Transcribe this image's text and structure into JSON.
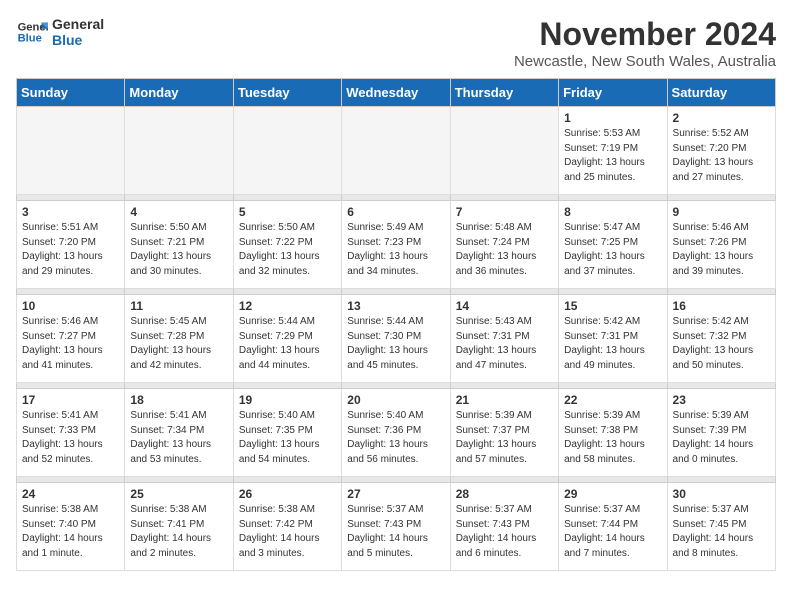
{
  "logo": {
    "line1": "General",
    "line2": "Blue"
  },
  "title": "November 2024",
  "location": "Newcastle, New South Wales, Australia",
  "weekdays": [
    "Sunday",
    "Monday",
    "Tuesday",
    "Wednesday",
    "Thursday",
    "Friday",
    "Saturday"
  ],
  "weeks": [
    [
      {
        "day": "",
        "details": ""
      },
      {
        "day": "",
        "details": ""
      },
      {
        "day": "",
        "details": ""
      },
      {
        "day": "",
        "details": ""
      },
      {
        "day": "",
        "details": ""
      },
      {
        "day": "1",
        "details": "Sunrise: 5:53 AM\nSunset: 7:19 PM\nDaylight: 13 hours\nand 25 minutes."
      },
      {
        "day": "2",
        "details": "Sunrise: 5:52 AM\nSunset: 7:20 PM\nDaylight: 13 hours\nand 27 minutes."
      }
    ],
    [
      {
        "day": "3",
        "details": "Sunrise: 5:51 AM\nSunset: 7:20 PM\nDaylight: 13 hours\nand 29 minutes."
      },
      {
        "day": "4",
        "details": "Sunrise: 5:50 AM\nSunset: 7:21 PM\nDaylight: 13 hours\nand 30 minutes."
      },
      {
        "day": "5",
        "details": "Sunrise: 5:50 AM\nSunset: 7:22 PM\nDaylight: 13 hours\nand 32 minutes."
      },
      {
        "day": "6",
        "details": "Sunrise: 5:49 AM\nSunset: 7:23 PM\nDaylight: 13 hours\nand 34 minutes."
      },
      {
        "day": "7",
        "details": "Sunrise: 5:48 AM\nSunset: 7:24 PM\nDaylight: 13 hours\nand 36 minutes."
      },
      {
        "day": "8",
        "details": "Sunrise: 5:47 AM\nSunset: 7:25 PM\nDaylight: 13 hours\nand 37 minutes."
      },
      {
        "day": "9",
        "details": "Sunrise: 5:46 AM\nSunset: 7:26 PM\nDaylight: 13 hours\nand 39 minutes."
      }
    ],
    [
      {
        "day": "10",
        "details": "Sunrise: 5:46 AM\nSunset: 7:27 PM\nDaylight: 13 hours\nand 41 minutes."
      },
      {
        "day": "11",
        "details": "Sunrise: 5:45 AM\nSunset: 7:28 PM\nDaylight: 13 hours\nand 42 minutes."
      },
      {
        "day": "12",
        "details": "Sunrise: 5:44 AM\nSunset: 7:29 PM\nDaylight: 13 hours\nand 44 minutes."
      },
      {
        "day": "13",
        "details": "Sunrise: 5:44 AM\nSunset: 7:30 PM\nDaylight: 13 hours\nand 45 minutes."
      },
      {
        "day": "14",
        "details": "Sunrise: 5:43 AM\nSunset: 7:31 PM\nDaylight: 13 hours\nand 47 minutes."
      },
      {
        "day": "15",
        "details": "Sunrise: 5:42 AM\nSunset: 7:31 PM\nDaylight: 13 hours\nand 49 minutes."
      },
      {
        "day": "16",
        "details": "Sunrise: 5:42 AM\nSunset: 7:32 PM\nDaylight: 13 hours\nand 50 minutes."
      }
    ],
    [
      {
        "day": "17",
        "details": "Sunrise: 5:41 AM\nSunset: 7:33 PM\nDaylight: 13 hours\nand 52 minutes."
      },
      {
        "day": "18",
        "details": "Sunrise: 5:41 AM\nSunset: 7:34 PM\nDaylight: 13 hours\nand 53 minutes."
      },
      {
        "day": "19",
        "details": "Sunrise: 5:40 AM\nSunset: 7:35 PM\nDaylight: 13 hours\nand 54 minutes."
      },
      {
        "day": "20",
        "details": "Sunrise: 5:40 AM\nSunset: 7:36 PM\nDaylight: 13 hours\nand 56 minutes."
      },
      {
        "day": "21",
        "details": "Sunrise: 5:39 AM\nSunset: 7:37 PM\nDaylight: 13 hours\nand 57 minutes."
      },
      {
        "day": "22",
        "details": "Sunrise: 5:39 AM\nSunset: 7:38 PM\nDaylight: 13 hours\nand 58 minutes."
      },
      {
        "day": "23",
        "details": "Sunrise: 5:39 AM\nSunset: 7:39 PM\nDaylight: 14 hours\nand 0 minutes."
      }
    ],
    [
      {
        "day": "24",
        "details": "Sunrise: 5:38 AM\nSunset: 7:40 PM\nDaylight: 14 hours\nand 1 minute."
      },
      {
        "day": "25",
        "details": "Sunrise: 5:38 AM\nSunset: 7:41 PM\nDaylight: 14 hours\nand 2 minutes."
      },
      {
        "day": "26",
        "details": "Sunrise: 5:38 AM\nSunset: 7:42 PM\nDaylight: 14 hours\nand 3 minutes."
      },
      {
        "day": "27",
        "details": "Sunrise: 5:37 AM\nSunset: 7:43 PM\nDaylight: 14 hours\nand 5 minutes."
      },
      {
        "day": "28",
        "details": "Sunrise: 5:37 AM\nSunset: 7:43 PM\nDaylight: 14 hours\nand 6 minutes."
      },
      {
        "day": "29",
        "details": "Sunrise: 5:37 AM\nSunset: 7:44 PM\nDaylight: 14 hours\nand 7 minutes."
      },
      {
        "day": "30",
        "details": "Sunrise: 5:37 AM\nSunset: 7:45 PM\nDaylight: 14 hours\nand 8 minutes."
      }
    ]
  ]
}
